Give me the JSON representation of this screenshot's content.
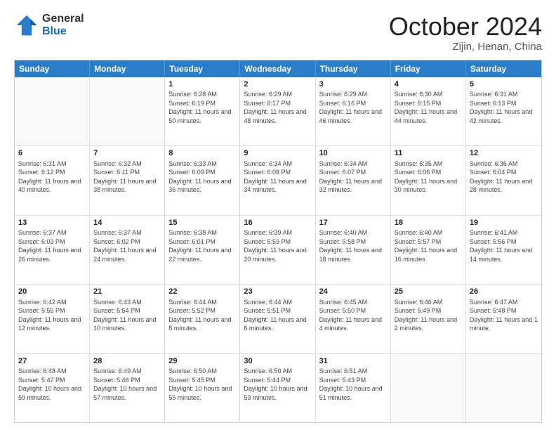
{
  "header": {
    "logo_general": "General",
    "logo_blue": "Blue",
    "title": "October 2024",
    "location": "Zijin, Henan, China"
  },
  "days": [
    "Sunday",
    "Monday",
    "Tuesday",
    "Wednesday",
    "Thursday",
    "Friday",
    "Saturday"
  ],
  "weeks": [
    [
      {
        "day": "",
        "sunrise": "",
        "sunset": "",
        "daylight": ""
      },
      {
        "day": "",
        "sunrise": "",
        "sunset": "",
        "daylight": ""
      },
      {
        "day": "1",
        "sunrise": "Sunrise: 6:28 AM",
        "sunset": "Sunset: 6:19 PM",
        "daylight": "Daylight: 11 hours and 50 minutes."
      },
      {
        "day": "2",
        "sunrise": "Sunrise: 6:29 AM",
        "sunset": "Sunset: 6:17 PM",
        "daylight": "Daylight: 11 hours and 48 minutes."
      },
      {
        "day": "3",
        "sunrise": "Sunrise: 6:29 AM",
        "sunset": "Sunset: 6:16 PM",
        "daylight": "Daylight: 11 hours and 46 minutes."
      },
      {
        "day": "4",
        "sunrise": "Sunrise: 6:30 AM",
        "sunset": "Sunset: 6:15 PM",
        "daylight": "Daylight: 11 hours and 44 minutes."
      },
      {
        "day": "5",
        "sunrise": "Sunrise: 6:31 AM",
        "sunset": "Sunset: 6:13 PM",
        "daylight": "Daylight: 11 hours and 42 minutes."
      }
    ],
    [
      {
        "day": "6",
        "sunrise": "Sunrise: 6:31 AM",
        "sunset": "Sunset: 6:12 PM",
        "daylight": "Daylight: 11 hours and 40 minutes."
      },
      {
        "day": "7",
        "sunrise": "Sunrise: 6:32 AM",
        "sunset": "Sunset: 6:11 PM",
        "daylight": "Daylight: 11 hours and 38 minutes."
      },
      {
        "day": "8",
        "sunrise": "Sunrise: 6:33 AM",
        "sunset": "Sunset: 6:09 PM",
        "daylight": "Daylight: 11 hours and 36 minutes."
      },
      {
        "day": "9",
        "sunrise": "Sunrise: 6:34 AM",
        "sunset": "Sunset: 6:08 PM",
        "daylight": "Daylight: 11 hours and 34 minutes."
      },
      {
        "day": "10",
        "sunrise": "Sunrise: 6:34 AM",
        "sunset": "Sunset: 6:07 PM",
        "daylight": "Daylight: 11 hours and 32 minutes."
      },
      {
        "day": "11",
        "sunrise": "Sunrise: 6:35 AM",
        "sunset": "Sunset: 6:06 PM",
        "daylight": "Daylight: 11 hours and 30 minutes."
      },
      {
        "day": "12",
        "sunrise": "Sunrise: 6:36 AM",
        "sunset": "Sunset: 6:04 PM",
        "daylight": "Daylight: 11 hours and 28 minutes."
      }
    ],
    [
      {
        "day": "13",
        "sunrise": "Sunrise: 6:37 AM",
        "sunset": "Sunset: 6:03 PM",
        "daylight": "Daylight: 11 hours and 26 minutes."
      },
      {
        "day": "14",
        "sunrise": "Sunrise: 6:37 AM",
        "sunset": "Sunset: 6:02 PM",
        "daylight": "Daylight: 11 hours and 24 minutes."
      },
      {
        "day": "15",
        "sunrise": "Sunrise: 6:38 AM",
        "sunset": "Sunset: 6:01 PM",
        "daylight": "Daylight: 11 hours and 22 minutes."
      },
      {
        "day": "16",
        "sunrise": "Sunrise: 6:39 AM",
        "sunset": "Sunset: 5:59 PM",
        "daylight": "Daylight: 11 hours and 20 minutes."
      },
      {
        "day": "17",
        "sunrise": "Sunrise: 6:40 AM",
        "sunset": "Sunset: 5:58 PM",
        "daylight": "Daylight: 11 hours and 18 minutes."
      },
      {
        "day": "18",
        "sunrise": "Sunrise: 6:40 AM",
        "sunset": "Sunset: 5:57 PM",
        "daylight": "Daylight: 11 hours and 16 minutes."
      },
      {
        "day": "19",
        "sunrise": "Sunrise: 6:41 AM",
        "sunset": "Sunset: 5:56 PM",
        "daylight": "Daylight: 11 hours and 14 minutes."
      }
    ],
    [
      {
        "day": "20",
        "sunrise": "Sunrise: 6:42 AM",
        "sunset": "Sunset: 5:55 PM",
        "daylight": "Daylight: 11 hours and 12 minutes."
      },
      {
        "day": "21",
        "sunrise": "Sunrise: 6:43 AM",
        "sunset": "Sunset: 5:54 PM",
        "daylight": "Daylight: 11 hours and 10 minutes."
      },
      {
        "day": "22",
        "sunrise": "Sunrise: 6:44 AM",
        "sunset": "Sunset: 5:52 PM",
        "daylight": "Daylight: 11 hours and 8 minutes."
      },
      {
        "day": "23",
        "sunrise": "Sunrise: 6:44 AM",
        "sunset": "Sunset: 5:51 PM",
        "daylight": "Daylight: 11 hours and 6 minutes."
      },
      {
        "day": "24",
        "sunrise": "Sunrise: 6:45 AM",
        "sunset": "Sunset: 5:50 PM",
        "daylight": "Daylight: 11 hours and 4 minutes."
      },
      {
        "day": "25",
        "sunrise": "Sunrise: 6:46 AM",
        "sunset": "Sunset: 5:49 PM",
        "daylight": "Daylight: 11 hours and 2 minutes."
      },
      {
        "day": "26",
        "sunrise": "Sunrise: 6:47 AM",
        "sunset": "Sunset: 5:48 PM",
        "daylight": "Daylight: 11 hours and 1 minute."
      }
    ],
    [
      {
        "day": "27",
        "sunrise": "Sunrise: 6:48 AM",
        "sunset": "Sunset: 5:47 PM",
        "daylight": "Daylight: 10 hours and 59 minutes."
      },
      {
        "day": "28",
        "sunrise": "Sunrise: 6:49 AM",
        "sunset": "Sunset: 5:46 PM",
        "daylight": "Daylight: 10 hours and 57 minutes."
      },
      {
        "day": "29",
        "sunrise": "Sunrise: 6:50 AM",
        "sunset": "Sunset: 5:45 PM",
        "daylight": "Daylight: 10 hours and 55 minutes."
      },
      {
        "day": "30",
        "sunrise": "Sunrise: 6:50 AM",
        "sunset": "Sunset: 5:44 PM",
        "daylight": "Daylight: 10 hours and 53 minutes."
      },
      {
        "day": "31",
        "sunrise": "Sunrise: 6:51 AM",
        "sunset": "Sunset: 5:43 PM",
        "daylight": "Daylight: 10 hours and 51 minutes."
      },
      {
        "day": "",
        "sunrise": "",
        "sunset": "",
        "daylight": ""
      },
      {
        "day": "",
        "sunrise": "",
        "sunset": "",
        "daylight": ""
      }
    ]
  ]
}
